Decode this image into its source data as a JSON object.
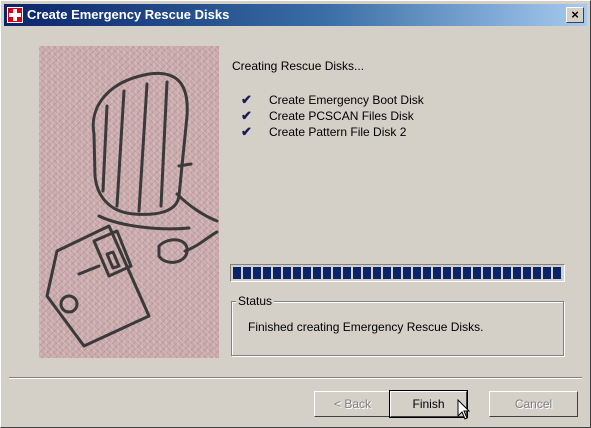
{
  "window": {
    "title": "Create Emergency Rescue Disks",
    "close_label": "×"
  },
  "icons": {
    "app": "rescue-disk-icon",
    "art": "computer-and-floppy-illustration",
    "check": "checkmark-icon",
    "cursor": "mouse-pointer-icon"
  },
  "main": {
    "heading": "Creating Rescue Disks...",
    "check_glyph": "✔",
    "steps": [
      {
        "label": "Create Emergency Boot Disk"
      },
      {
        "label": "Create PCSCAN Files Disk"
      },
      {
        "label": "Create Pattern File Disk 2"
      }
    ]
  },
  "progress": {
    "value": 1.0
  },
  "status": {
    "legend": "Status",
    "text": "Finished creating Emergency Rescue Disks."
  },
  "buttons": {
    "back": "< Back",
    "finish": "Finish",
    "cancel": "Cancel"
  },
  "colors": {
    "title_start": "#0a246a",
    "title_end": "#a6caf0",
    "progress": "#0a246a",
    "face": "#d4d0c8"
  }
}
